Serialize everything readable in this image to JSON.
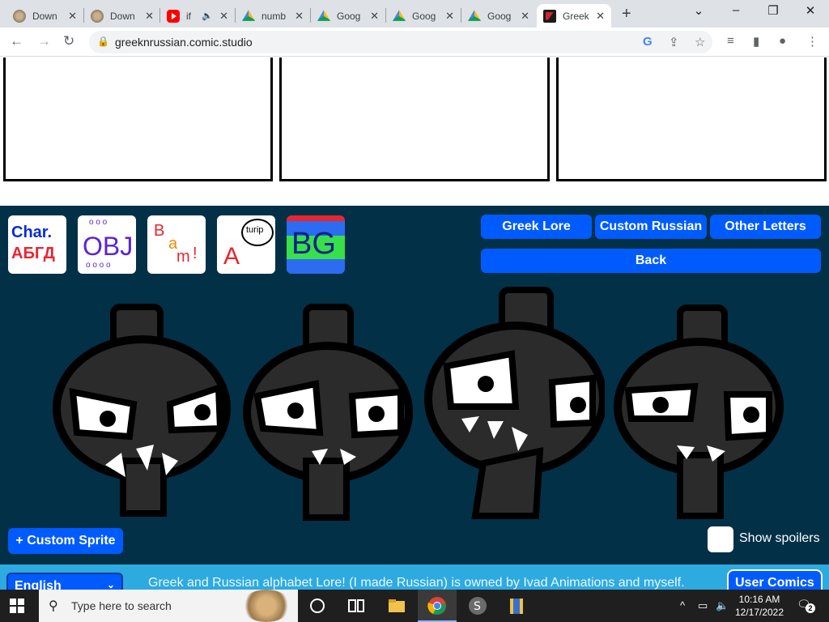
{
  "browser": {
    "tabs": [
      {
        "title": "Down",
        "favicon": "lion-icon"
      },
      {
        "title": "Down",
        "favicon": "lion-icon"
      },
      {
        "title": "if",
        "favicon": "youtube-icon"
      },
      {
        "title": "numb",
        "favicon": "drive-icon"
      },
      {
        "title": "Goog",
        "favicon": "drive-icon"
      },
      {
        "title": "Goog",
        "favicon": "drive-icon"
      },
      {
        "title": "Goog",
        "favicon": "drive-icon"
      },
      {
        "title": "Greek",
        "favicon": "greek-icon"
      }
    ],
    "url": "greeknrussian.comic.studio"
  },
  "categories": [
    {
      "name": "char",
      "line1": "Char.",
      "line2": "АБГД"
    },
    {
      "name": "obj",
      "text": "OBJ"
    },
    {
      "name": "bam",
      "letters": [
        "B",
        "a",
        "m",
        "!"
      ]
    },
    {
      "name": "text",
      "bubble": "turip",
      "letter": "A"
    },
    {
      "name": "bg",
      "text": "BG"
    }
  ],
  "tabs": {
    "greek_lore": "Greek Lore",
    "custom_russian": "Custom Russian",
    "other_letters": "Other Letters",
    "back": "Back"
  },
  "editor": {
    "custom_sprite": "+ Custom Sprite",
    "show_spoilers": "Show spoilers"
  },
  "footer": {
    "language": "English",
    "credit": "Greek and Russian alphabet Lore! (I made Russian) is owned by Ivad Animations and myself.",
    "user_comics": "User Comics"
  },
  "taskbar": {
    "search_placeholder": "Type here to search",
    "time": "10:16 AM",
    "date": "12/17/2022",
    "notifications": "2"
  },
  "colors": {
    "editor_bg": "#023047",
    "button_blue": "#005bff",
    "footer_bg": "#2daae0"
  }
}
